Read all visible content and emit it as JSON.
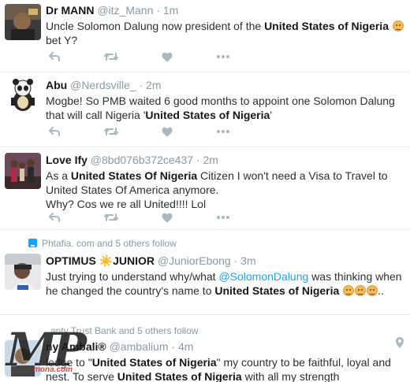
{
  "tweets": [
    {
      "name": "Dr MANN",
      "handle": "@itz_Mann",
      "dot": "·",
      "time": "1m",
      "text_segments": [
        {
          "t": "Uncle Solomon Dalung now president of the ",
          "s": "plain"
        },
        {
          "t": "United States of Nigeria",
          "s": "bold"
        },
        {
          "t": " ",
          "s": "plain"
        },
        {
          "t": "",
          "s": "emoji"
        },
        {
          "t": " bet Y?",
          "s": "plain"
        }
      ]
    },
    {
      "name": "Abu",
      "handle": "@Nerdsville_",
      "dot": "·",
      "time": "2m",
      "text_segments": [
        {
          "t": "Mogbe!  So PMB waited 6 good months to appoint one Solomon Dalung that will call Nigeria '",
          "s": "plain"
        },
        {
          "t": "United States of Nigeria",
          "s": "bold"
        },
        {
          "t": "'",
          "s": "plain"
        }
      ]
    },
    {
      "name": "Love Ify",
      "handle": "@8bd076b372ce437",
      "dot": "·",
      "time": "2m",
      "text_segments": [
        {
          "t": "As a ",
          "s": "plain"
        },
        {
          "t": "United States Of Nigeria",
          "s": "bold"
        },
        {
          "t": " Citizen I won't need a Visa to Travel to United States Of America anymore.",
          "s": "plain"
        },
        {
          "t": "",
          "s": "br"
        },
        {
          "t": "Why? Cos we re all United!!!! Lol",
          "s": "plain"
        }
      ]
    },
    {
      "context": "Phtafia. com and 5 others follow",
      "name": "OPTIMUS ☀️JUNIOR",
      "handle": "@JuniorEbong",
      "dot": "·",
      "time": "3m",
      "text_segments": [
        {
          "t": "Just trying to understand why/what ",
          "s": "plain"
        },
        {
          "t": "@SolomonDalung",
          "s": "mention"
        },
        {
          "t": " was thinking when he changed the country's name to ",
          "s": "plain"
        },
        {
          "t": "United States of Nigeria",
          "s": "bold"
        },
        {
          "t": " ",
          "s": "plain"
        },
        {
          "t": "",
          "s": "emoji"
        },
        {
          "t": "",
          "s": "emoji"
        },
        {
          "t": "",
          "s": "emoji"
        },
        {
          "t": "..",
          "s": "plain"
        }
      ]
    },
    {
      "context": "anty Trust Bank and 5 others follow",
      "name": "ny Ambali®",
      "handle": "@ambalium",
      "dot": "·",
      "time": "4m",
      "text_segments": [
        {
          "t": "ledge to \"",
          "s": "plain"
        },
        {
          "t": "United States of Nigeria",
          "s": "bold"
        },
        {
          "t": "\" my country to be faithful, loyal and nest. To serve ",
          "s": "plain"
        },
        {
          "t": "United States of Nigeria",
          "s": "bold"
        },
        {
          "t": "  with all my strength",
          "s": "plain"
        }
      ]
    }
  ],
  "icons": {
    "reply": "reply-icon",
    "retweet": "retweet-icon",
    "like": "heart-icon",
    "more": "more-icon",
    "location": "pin-icon"
  },
  "colors": {
    "icon": "#aab8c2",
    "link": "#1da1f2",
    "muted": "#8899a6"
  },
  "watermark": {
    "letters": "MP",
    "sub": "mona.com"
  }
}
